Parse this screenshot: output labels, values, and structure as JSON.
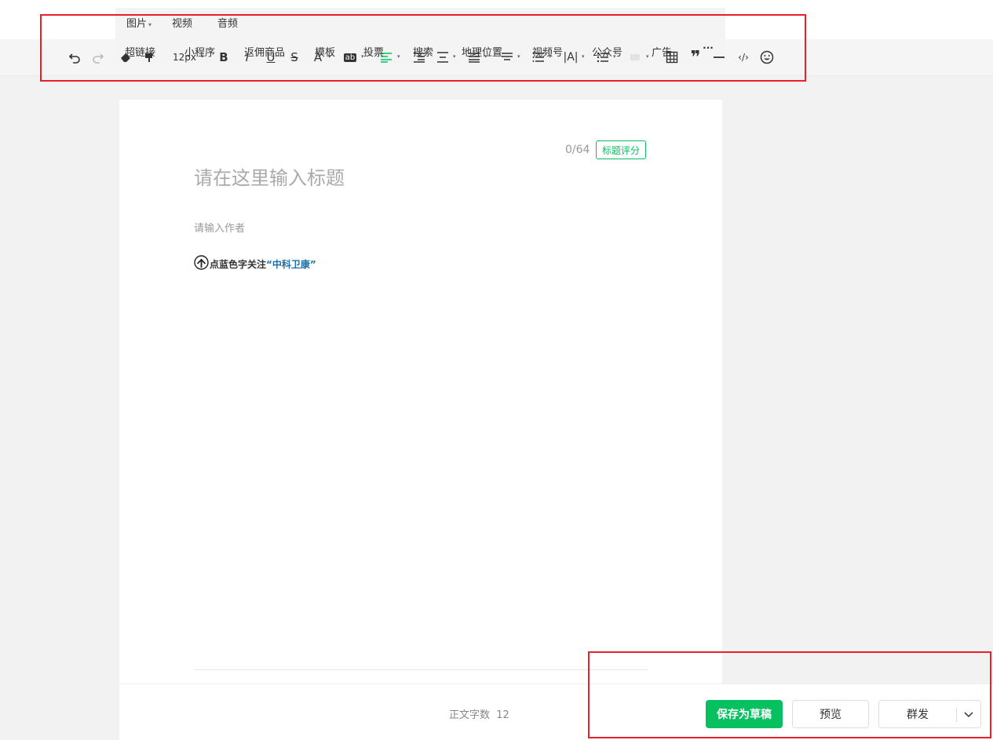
{
  "insert_menu": {
    "row1": [
      "图片",
      "视频",
      "音频"
    ],
    "row2": [
      "超链接",
      "小程序",
      "返佣商品",
      "模板",
      "投票",
      "搜索",
      "地理位置",
      "视频号",
      "公众号",
      "广告"
    ]
  },
  "toolbar": {
    "font_size": "12px",
    "bold": "B",
    "italic": "I",
    "underline": "U",
    "strike": "S",
    "font_color": "A",
    "highlight": "ab",
    "letter_spacing": "|A|",
    "more": "···"
  },
  "editor": {
    "title_count": "0/64",
    "title_score_label": "标题评分",
    "title_placeholder": "请在这里输入标题",
    "author_placeholder": "请输入作者",
    "body_text": "点蓝色字关注",
    "body_highlight": "“中科卫康”"
  },
  "footer": {
    "word_count_label": "正文字数",
    "word_count": "12",
    "save_draft": "保存为草稿",
    "preview": "预览",
    "publish": "群发"
  },
  "colors": {
    "accent": "#07c160",
    "highlight_box": "#e8202a",
    "link_blue": "#1e6fa8"
  }
}
